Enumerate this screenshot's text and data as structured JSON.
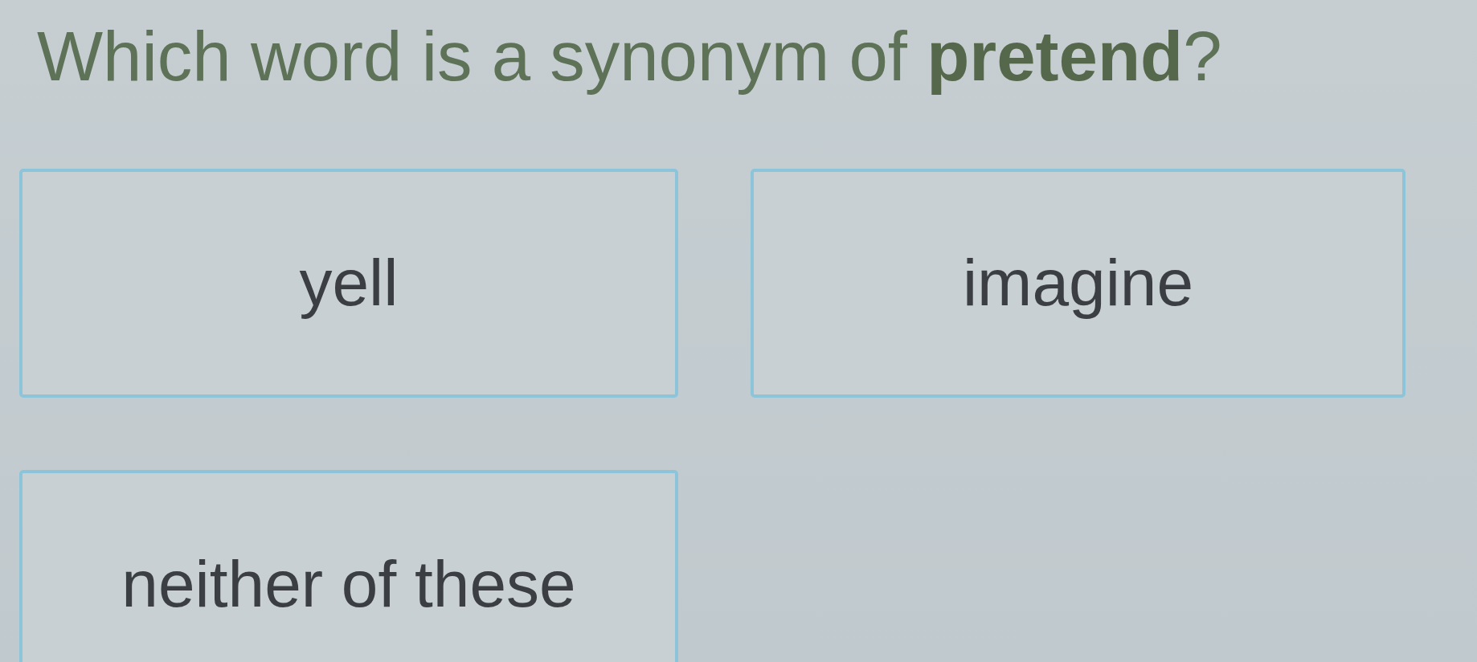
{
  "question": "Which word is a synonym of **pretend**?",
  "choices": [
    {
      "label": "yell"
    },
    {
      "label": "imagine"
    },
    {
      "label": "neither of these"
    }
  ]
}
